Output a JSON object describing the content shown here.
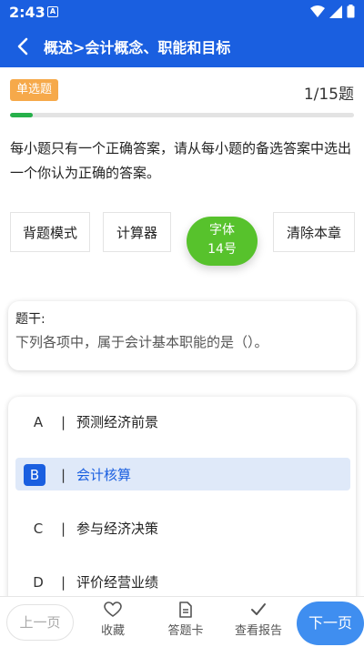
{
  "status_bar": {
    "time": "2:43",
    "app_icon": "A"
  },
  "header": {
    "title": "概述>会计概念、职能和目标"
  },
  "question": {
    "type_badge": "单选题",
    "progress_text": "1/15题",
    "progress_fraction": 0.0667,
    "instructions": "每小题只有一个正确答案，请从每小题的备选答案中选出一个你认为正确的答案。",
    "stem_label": "题干:",
    "stem_text": "下列各项中，属于会计基本职能的是（）。"
  },
  "tools": {
    "recite_mode": "背题模式",
    "calculator": "计算器",
    "font_line1": "字体",
    "font_line2": "14号",
    "clear_chapter": "清除本章"
  },
  "options": [
    {
      "letter": "A",
      "separator": "|",
      "text": "预测经济前景",
      "selected": false
    },
    {
      "letter": "B",
      "separator": "|",
      "text": "会计核算",
      "selected": true
    },
    {
      "letter": "C",
      "separator": "|",
      "text": "参与经济决策",
      "selected": false
    },
    {
      "letter": "D",
      "separator": "|",
      "text": "评价经营业绩",
      "selected": false
    }
  ],
  "bottom_nav": {
    "prev": "上一页",
    "favorite": "收藏",
    "answer_card": "答题卡",
    "report": "查看报告",
    "next": "下一页"
  },
  "colors": {
    "primary": "#1a5fe0",
    "accent_green": "#57c22c",
    "badge": "#f6a94a",
    "next_button": "#3f8ef0"
  }
}
